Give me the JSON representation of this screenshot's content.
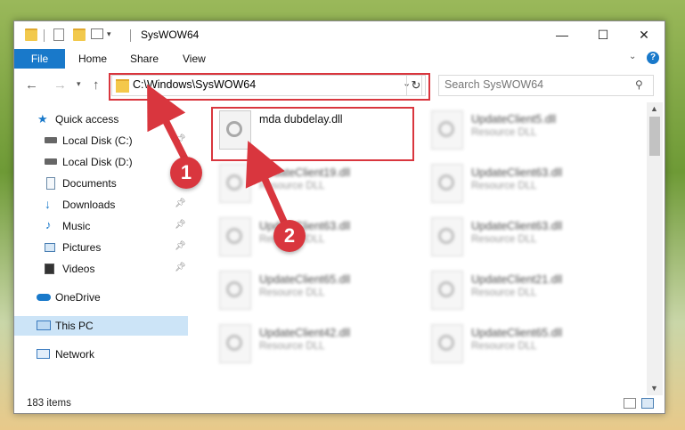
{
  "window": {
    "title": "SysWOW64",
    "minimize": "—",
    "maximize": "☐",
    "close": "✕"
  },
  "ribbon": {
    "tabs": [
      "File",
      "Home",
      "Share",
      "View"
    ],
    "expand": "⌄",
    "help": "?"
  },
  "address": {
    "path": "C:\\Windows\\SysWOW64",
    "search_placeholder": "Search SysWOW64"
  },
  "sidebar": {
    "items": [
      {
        "label": "Quick access",
        "icon": "star-icon"
      },
      {
        "label": "Local Disk (C:)",
        "icon": "drive-icon"
      },
      {
        "label": "Local Disk (D:)",
        "icon": "drive-icon"
      },
      {
        "label": "Documents",
        "icon": "documents-icon"
      },
      {
        "label": "Downloads",
        "icon": "downloads-icon"
      },
      {
        "label": "Music",
        "icon": "music-icon"
      },
      {
        "label": "Pictures",
        "icon": "pictures-icon"
      },
      {
        "label": "Videos",
        "icon": "videos-icon"
      },
      {
        "label": "OneDrive",
        "icon": "cloud-icon"
      },
      {
        "label": "This PC",
        "icon": "computer-icon"
      },
      {
        "label": "Network",
        "icon": "network-icon"
      }
    ]
  },
  "files": [
    {
      "name": "mda dubdelay.dll",
      "type": ""
    },
    {
      "name": "UpdateClient5.dll",
      "type": "Resource DLL"
    },
    {
      "name": "UpdateClient19.dll",
      "type": "Resource DLL"
    },
    {
      "name": "UpdateClient63.dll",
      "type": "Resource DLL"
    },
    {
      "name": "UpdateClient63.dll",
      "type": "Resource DLL"
    },
    {
      "name": "UpdateClient63.dll",
      "type": "Resource DLL"
    },
    {
      "name": "UpdateClient65.dll",
      "type": "Resource DLL"
    },
    {
      "name": "UpdateClient21.dll",
      "type": "Resource DLL"
    },
    {
      "name": "UpdateClient42.dll",
      "type": "Resource DLL"
    },
    {
      "name": "UpdateClient65.dll",
      "type": "Resource DLL"
    }
  ],
  "status": {
    "item_count": "183 items"
  },
  "callouts": [
    "1",
    "2"
  ],
  "colors": {
    "accent": "#1979ca",
    "highlight": "#d9363e",
    "selected": "#cce4f7"
  }
}
